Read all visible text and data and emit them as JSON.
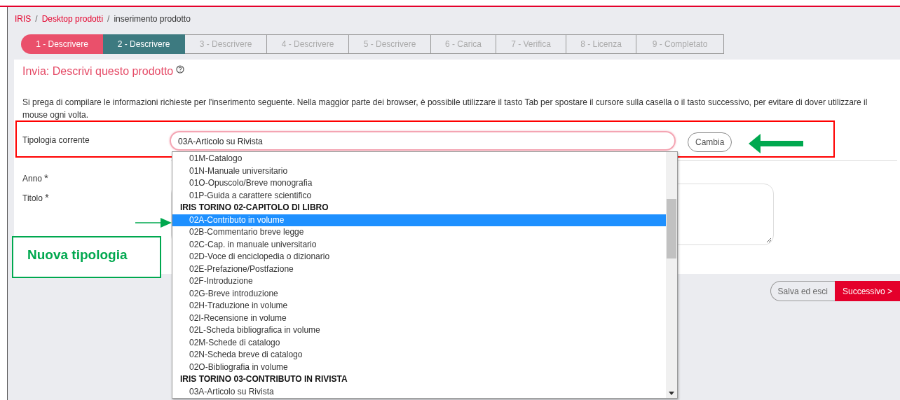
{
  "breadcrumb": [
    {
      "label": "IRIS",
      "kind": "link"
    },
    {
      "label": "/",
      "kind": "separator"
    },
    {
      "label": "Desktop prodotti",
      "kind": "link"
    },
    {
      "label": "/",
      "kind": "separator"
    },
    {
      "label": "inserimento prodotto",
      "kind": "current"
    }
  ],
  "steps": [
    {
      "label": "1 - Descrivere",
      "kind": "done"
    },
    {
      "label": "2 - Descrivere",
      "kind": "current"
    },
    {
      "label": "3 - Descrivere",
      "kind": "todo"
    },
    {
      "label": "4 - Descrivere",
      "kind": "todo"
    },
    {
      "label": "5 - Descrivere",
      "kind": "todo"
    },
    {
      "label": "6 - Carica",
      "kind": "todo"
    },
    {
      "label": "7 - Verifica",
      "kind": "todo"
    },
    {
      "label": "8 - Licenza",
      "kind": "todo"
    },
    {
      "label": "9 - Completato",
      "kind": "todo"
    }
  ],
  "form": {
    "title": "Invia: Descrivi questo prodotto",
    "intro": "Si prega di compilare le informazioni richieste per l'inserimento seguente. Nella maggior parte dei browser, è possibile utilizzare il tasto Tab per spostare il cursore sulla casella o il tasto successivo, per evitare di dover utilizzare il mouse ogni volta.",
    "current_type": {
      "label": "Tipologia corrente",
      "value": "03A-Articolo su Rivista",
      "button": "Cambia"
    },
    "fields": [
      {
        "label": "Anno",
        "required_mark": "*"
      },
      {
        "label": "Titolo",
        "required_mark": "*"
      }
    ]
  },
  "dropdown": {
    "options": [
      {
        "label": "01M-Catalogo",
        "kind": "option",
        "selected": false
      },
      {
        "label": "01N-Manuale universitario",
        "kind": "option",
        "selected": false
      },
      {
        "label": "01O-Opuscolo/Breve monografia",
        "kind": "option",
        "selected": false
      },
      {
        "label": "01P-Guida a carattere scientifico",
        "kind": "option",
        "selected": false
      },
      {
        "label": "IRIS TORINO 02-CAPITOLO DI LIBRO",
        "kind": "group",
        "selected": false
      },
      {
        "label": "02A-Contributo in volume",
        "kind": "option",
        "selected": true
      },
      {
        "label": "02B-Commentario breve legge",
        "kind": "option",
        "selected": false
      },
      {
        "label": "02C-Cap. in manuale universitario",
        "kind": "option",
        "selected": false
      },
      {
        "label": "02D-Voce di enciclopedia o dizionario",
        "kind": "option",
        "selected": false
      },
      {
        "label": "02E-Prefazione/Postfazione",
        "kind": "option",
        "selected": false
      },
      {
        "label": "02F-Introduzione",
        "kind": "option",
        "selected": false
      },
      {
        "label": "02G-Breve introduzione",
        "kind": "option",
        "selected": false
      },
      {
        "label": "02H-Traduzione in volume",
        "kind": "option",
        "selected": false
      },
      {
        "label": "02I-Recensione in volume",
        "kind": "option",
        "selected": false
      },
      {
        "label": "02L-Scheda bibliografica in volume",
        "kind": "option",
        "selected": false
      },
      {
        "label": "02M-Schede di catalogo",
        "kind": "option",
        "selected": false
      },
      {
        "label": "02N-Scheda breve di catalogo",
        "kind": "option",
        "selected": false
      },
      {
        "label": "02O-Bibliografia in volume",
        "kind": "option",
        "selected": false
      },
      {
        "label": "IRIS TORINO 03-CONTRIBUTO IN RIVISTA",
        "kind": "group",
        "selected": false
      },
      {
        "label": "03A-Articolo su Rivista",
        "kind": "option",
        "selected": false
      }
    ]
  },
  "actions": [
    {
      "label": "Salva ed esci",
      "kind": "secondary"
    },
    {
      "label": "Successivo >",
      "kind": "primary"
    }
  ],
  "annotation": {
    "label": "Nuova tipologia"
  }
}
